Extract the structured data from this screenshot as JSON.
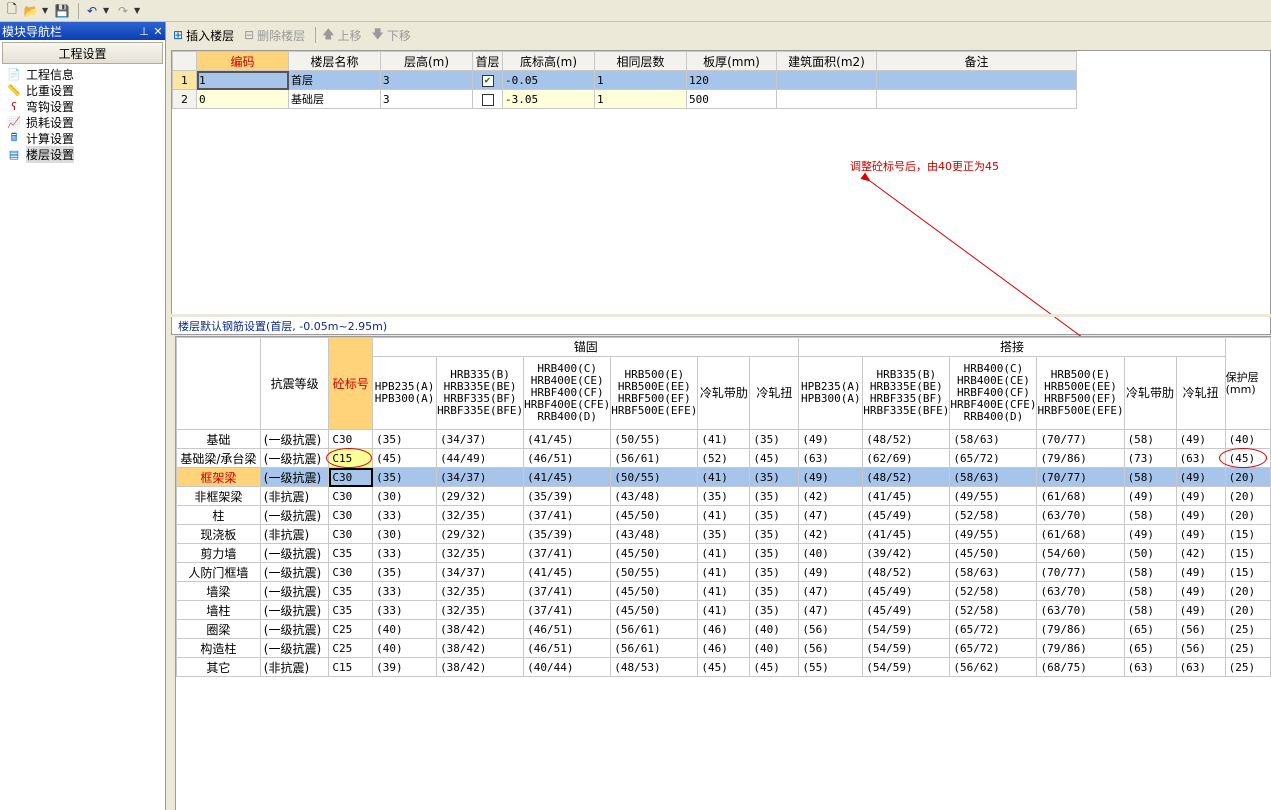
{
  "nav": {
    "title": "模块导航栏",
    "header": "工程设置",
    "items": [
      {
        "label": "工程信息",
        "icon": "info-page-icon"
      },
      {
        "label": "比重设置",
        "icon": "ruler-icon"
      },
      {
        "label": "弯钩设置",
        "icon": "hook-icon"
      },
      {
        "label": "损耗设置",
        "icon": "chart-icon"
      },
      {
        "label": "计算设置",
        "icon": "calc-icon"
      },
      {
        "label": "楼层设置",
        "icon": "floors-icon"
      }
    ]
  },
  "toolbar2": {
    "insert": "插入楼层",
    "delete": "删除楼层",
    "up": "上移",
    "down": "下移"
  },
  "floors": {
    "headers": [
      "编码",
      "楼层名称",
      "层高(m)",
      "首层",
      "底标高(m)",
      "相同层数",
      "板厚(mm)",
      "建筑面积(m2)",
      "备注"
    ],
    "rows": [
      {
        "rn": "1",
        "code": "1",
        "name": "首层",
        "height": "3",
        "first": true,
        "bottom": "-0.05",
        "same": "1",
        "thick": "120",
        "area": "",
        "note": ""
      },
      {
        "rn": "2",
        "code": "0",
        "name": "基础层",
        "height": "3",
        "first": false,
        "bottom": "-3.05",
        "same": "1",
        "thick": "500",
        "area": "",
        "note": ""
      }
    ]
  },
  "annotation": "调整砼标号后，由40更正为45",
  "rebar": {
    "section_title": "楼层默认钢筋设置(首层, -0.05m~2.95m)",
    "group_anchor": "锚固",
    "group_lap": "搭接",
    "h_grade": "抗震等级",
    "h_conc": "砼标号",
    "h_cover": "保护层(mm)",
    "h_cols": [
      "HPB235(A)\nHPB300(A)",
      "HRB335(B)\nHRB335E(BE)\nHRBF335(BF)\nHRBF335E(BFE)",
      "HRB400(C)\nHRB400E(CE)\nHRBF400(CF)\nHRBF400E(CFE)\nRRB400(D)",
      "HRB500(E)\nHRB500E(EE)\nHRBF500(EF)\nHRBF500E(EFE)",
      "冷轧带肋",
      "冷轧扭"
    ],
    "rows": [
      {
        "name": "基础",
        "grade": "(一级抗震)",
        "conc": "C30",
        "a": [
          "(35)",
          "(34/37)",
          "(41/45)",
          "(50/55)",
          "(41)",
          "(35)"
        ],
        "l": [
          "(49)",
          "(48/52)",
          "(58/63)",
          "(70/77)",
          "(58)",
          "(49)"
        ],
        "cover": "(40)"
      },
      {
        "name": "基础梁/承台梁",
        "grade": "(一级抗震)",
        "conc": "C15",
        "a": [
          "(45)",
          "(44/49)",
          "(46/51)",
          "(56/61)",
          "(52)",
          "(45)"
        ],
        "l": [
          "(63)",
          "(62/69)",
          "(65/72)",
          "(79/86)",
          "(73)",
          "(63)"
        ],
        "cover": "(45)"
      },
      {
        "name": "框架梁",
        "grade": "(一级抗震)",
        "conc": "C30",
        "a": [
          "(35)",
          "(34/37)",
          "(41/45)",
          "(50/55)",
          "(41)",
          "(35)"
        ],
        "l": [
          "(49)",
          "(48/52)",
          "(58/63)",
          "(70/77)",
          "(58)",
          "(49)"
        ],
        "cover": "(20)"
      },
      {
        "name": "非框架梁",
        "grade": "(非抗震)",
        "conc": "C30",
        "a": [
          "(30)",
          "(29/32)",
          "(35/39)",
          "(43/48)",
          "(35)",
          "(35)"
        ],
        "l": [
          "(42)",
          "(41/45)",
          "(49/55)",
          "(61/68)",
          "(49)",
          "(49)"
        ],
        "cover": "(20)"
      },
      {
        "name": "柱",
        "grade": "(一级抗震)",
        "conc": "C30",
        "a": [
          "(33)",
          "(32/35)",
          "(37/41)",
          "(45/50)",
          "(41)",
          "(35)"
        ],
        "l": [
          "(47)",
          "(45/49)",
          "(52/58)",
          "(63/70)",
          "(58)",
          "(49)"
        ],
        "cover": "(20)"
      },
      {
        "name": "现浇板",
        "grade": "(非抗震)",
        "conc": "C30",
        "a": [
          "(30)",
          "(29/32)",
          "(35/39)",
          "(43/48)",
          "(35)",
          "(35)"
        ],
        "l": [
          "(42)",
          "(41/45)",
          "(49/55)",
          "(61/68)",
          "(49)",
          "(49)"
        ],
        "cover": "(15)"
      },
      {
        "name": "剪力墙",
        "grade": "(一级抗震)",
        "conc": "C35",
        "a": [
          "(33)",
          "(32/35)",
          "(37/41)",
          "(45/50)",
          "(41)",
          "(35)"
        ],
        "l": [
          "(40)",
          "(39/42)",
          "(45/50)",
          "(54/60)",
          "(50)",
          "(42)"
        ],
        "cover": "(15)"
      },
      {
        "name": "人防门框墙",
        "grade": "(一级抗震)",
        "conc": "C30",
        "a": [
          "(35)",
          "(34/37)",
          "(41/45)",
          "(50/55)",
          "(41)",
          "(35)"
        ],
        "l": [
          "(49)",
          "(48/52)",
          "(58/63)",
          "(70/77)",
          "(58)",
          "(49)"
        ],
        "cover": "(15)"
      },
      {
        "name": "墙梁",
        "grade": "(一级抗震)",
        "conc": "C35",
        "a": [
          "(33)",
          "(32/35)",
          "(37/41)",
          "(45/50)",
          "(41)",
          "(35)"
        ],
        "l": [
          "(47)",
          "(45/49)",
          "(52/58)",
          "(63/70)",
          "(58)",
          "(49)"
        ],
        "cover": "(20)"
      },
      {
        "name": "墙柱",
        "grade": "(一级抗震)",
        "conc": "C35",
        "a": [
          "(33)",
          "(32/35)",
          "(37/41)",
          "(45/50)",
          "(41)",
          "(35)"
        ],
        "l": [
          "(47)",
          "(45/49)",
          "(52/58)",
          "(63/70)",
          "(58)",
          "(49)"
        ],
        "cover": "(20)"
      },
      {
        "name": "圈梁",
        "grade": "(一级抗震)",
        "conc": "C25",
        "a": [
          "(40)",
          "(38/42)",
          "(46/51)",
          "(56/61)",
          "(46)",
          "(40)"
        ],
        "l": [
          "(56)",
          "(54/59)",
          "(65/72)",
          "(79/86)",
          "(65)",
          "(56)"
        ],
        "cover": "(25)"
      },
      {
        "name": "构造柱",
        "grade": "(一级抗震)",
        "conc": "C25",
        "a": [
          "(40)",
          "(38/42)",
          "(46/51)",
          "(56/61)",
          "(46)",
          "(40)"
        ],
        "l": [
          "(56)",
          "(54/59)",
          "(65/72)",
          "(79/86)",
          "(65)",
          "(56)"
        ],
        "cover": "(25)"
      },
      {
        "name": "其它",
        "grade": "(非抗震)",
        "conc": "C15",
        "a": [
          "(39)",
          "(38/42)",
          "(40/44)",
          "(48/53)",
          "(45)",
          "(45)"
        ],
        "l": [
          "(55)",
          "(54/59)",
          "(56/62)",
          "(68/75)",
          "(63)",
          "(63)"
        ],
        "cover": "(25)"
      }
    ]
  }
}
